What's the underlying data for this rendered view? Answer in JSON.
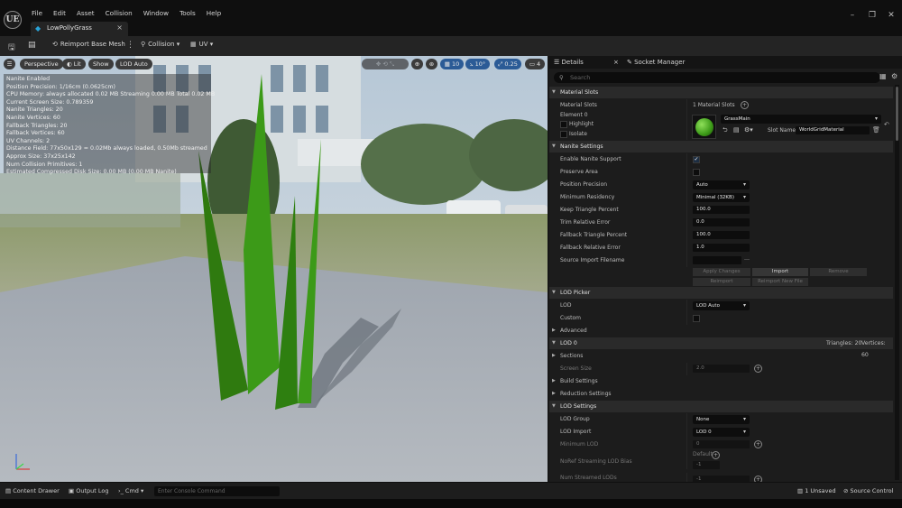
{
  "app": {
    "logo": "UE",
    "menu": [
      "File",
      "Edit",
      "Asset",
      "Collision",
      "Window",
      "Tools",
      "Help"
    ],
    "tab_title": "LowPollyGrass",
    "window_controls": [
      "minimize-icon",
      "restore-icon",
      "close-icon"
    ]
  },
  "toolbar": {
    "reimport_label": "Reimport Base Mesh",
    "collision_label": "Collision",
    "uv_label": "UV"
  },
  "viewport": {
    "perspective_label": "Perspective",
    "lit_label": "Lit",
    "show_label": "Show",
    "lod_label": "LOD Auto",
    "grid_snap": "10",
    "rotation_snap": "10°",
    "scale_snap": "0.25",
    "camera_speed": "4",
    "stats": [
      "Nanite Enabled",
      "Position Precision: 1/16cm (0.0625cm)",
      "CPU Memory: always allocated 0.02 MB Streaming 0.00 MB Total 0.02 MB",
      "Current Screen Size: 0.789359",
      "Nanite Triangles: 20",
      "Nanite Vertices: 60",
      "Fallback Triangles: 20",
      "Fallback Vertices: 60",
      "UV Channels: 2",
      "Distance Field: 77x50x129 = 0.02Mb always loaded, 0.50Mb streamed",
      "Approx Size: 37x25x142",
      "Num Collision Primitives: 1",
      "Estimated Compressed Disk Size: 0.00 MB (0.00 MB Nanite)"
    ]
  },
  "details": {
    "tab_details": "Details",
    "tab_socket": "Socket Manager",
    "search_placeholder": "Search",
    "material_slots": {
      "header": "Material Slots",
      "label": "Material Slots",
      "count": "1 Material Slots",
      "element": "Element 0",
      "highlight": "Highlight",
      "isolate": "Isolate",
      "material": "GrassMain",
      "slot_name_label": "Slot Name",
      "slot_name": "WorldGridMaterial"
    },
    "nanite": {
      "header": "Nanite Settings",
      "enable": "Enable Nanite Support",
      "preserve": "Preserve Area",
      "precision": "Position Precision",
      "precision_val": "Auto",
      "min_res": "Minimum Residency",
      "min_res_val": "Minimal (32KB)",
      "keep_tri": "Keep Triangle Percent",
      "keep_tri_val": "100.0",
      "trim_err": "Trim Relative Error",
      "trim_err_val": "0.0",
      "fb_tri": "Fallback Triangle Percent",
      "fb_tri_val": "100.0",
      "fb_err": "Fallback Relative Error",
      "fb_err_val": "1.0",
      "source": "Source Import Filename",
      "apply": "Apply Changes",
      "import": "Import",
      "remove": "Remove",
      "reimport": "Reimport",
      "reimport_new": "Reimport New File"
    },
    "lod_picker": {
      "header": "LOD Picker",
      "lod": "LOD",
      "lod_val": "LOD Auto",
      "custom": "Custom",
      "advanced": "Advanced"
    },
    "lod0": {
      "header": "LOD 0",
      "triangles": "Triangles: 20",
      "vertices": "Vertices: 60",
      "sections": "Sections",
      "screen_size": "Screen Size",
      "screen_size_val": "2.0",
      "build": "Build Settings",
      "reduction": "Reduction Settings"
    },
    "lod_settings": {
      "header": "LOD Settings",
      "group": "LOD Group",
      "group_val": "None",
      "import": "LOD Import",
      "import_val": "LOD 0",
      "min_lod": "Minimum LOD",
      "min_lod_val": "0",
      "default_label": "Default",
      "noref": "NoRef Streaming LOD Bias",
      "noref_val": "-1",
      "num_streamed": "Num Streamed LODs",
      "num_streamed_val": "-1"
    }
  },
  "statusbar": {
    "content_drawer": "Content Drawer",
    "output_log": "Output Log",
    "cmd": "Cmd",
    "console_placeholder": "Enter Console Command",
    "unsaved": "1 Unsaved",
    "source_control": "Source Control"
  },
  "colors": {
    "accent_blue": "#29a3d8",
    "grass_green": "#3c9a18",
    "panel_bg": "#1c1c1c",
    "section_bg": "#2a2a2a"
  }
}
